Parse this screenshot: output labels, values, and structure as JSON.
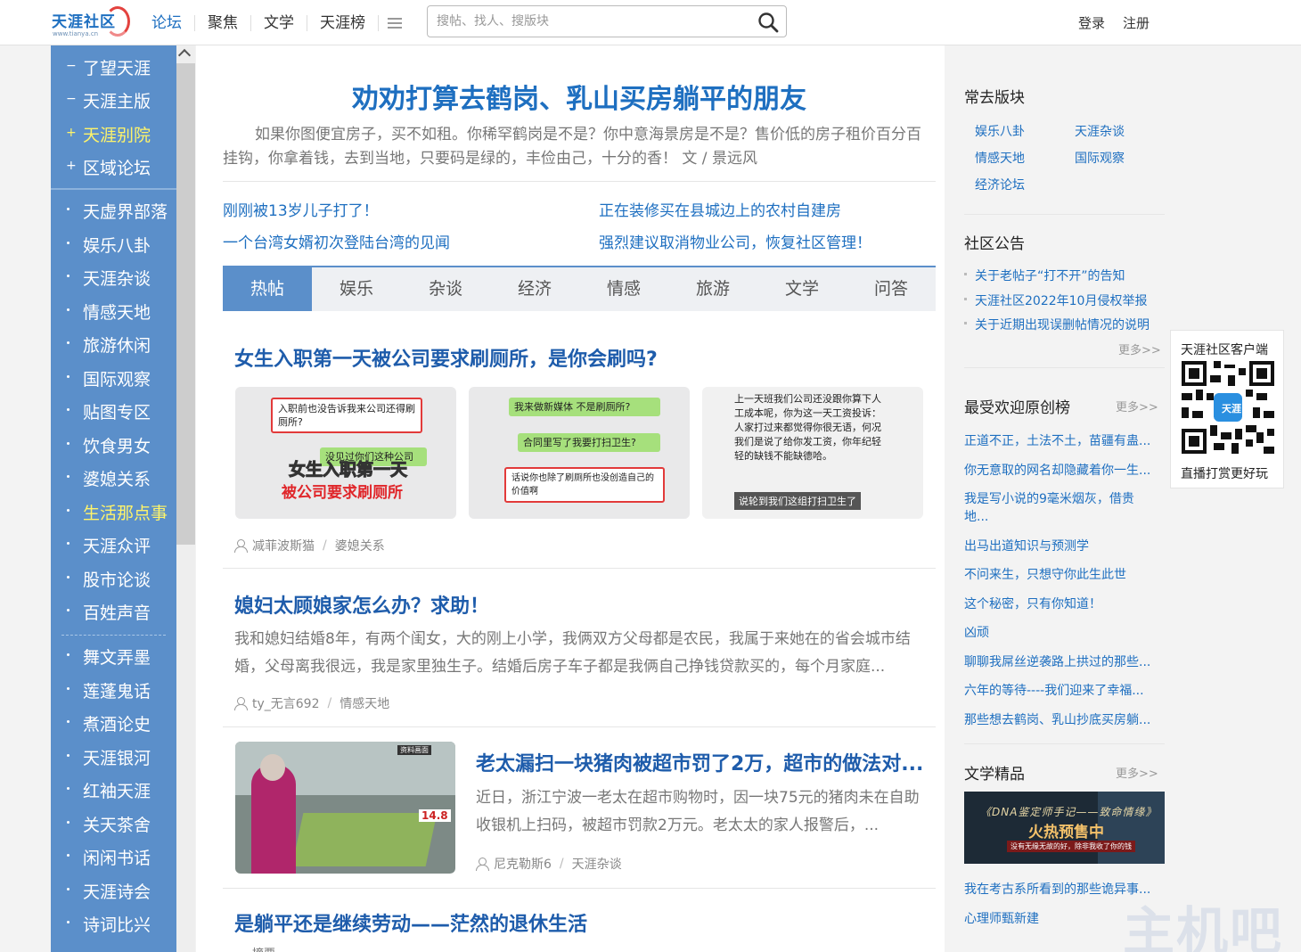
{
  "header": {
    "logo_text": "天涯社区",
    "logo_sub": "www.tianya.cn",
    "nav": [
      "论坛",
      "聚焦",
      "文学",
      "天涯榜"
    ],
    "search_placeholder": "搜帖、找人、搜版块",
    "login": "登录",
    "register": "注册"
  },
  "sidebar": {
    "top_items": [
      {
        "label": "了望天涯",
        "mark": "-",
        "active": false
      },
      {
        "label": "天涯主版",
        "mark": "-",
        "active": false
      },
      {
        "label": "天涯别院",
        "mark": "+",
        "active": true
      },
      {
        "label": "区域论坛",
        "mark": "+",
        "active": false
      }
    ],
    "group1": [
      "天虚界部落",
      "娱乐八卦",
      "天涯杂谈",
      "情感天地",
      "旅游休闲",
      "国际观察",
      "贴图专区",
      "饮食男女",
      "婆媳关系",
      "生活那点事",
      "天涯众评",
      "股市论谈",
      "百姓声音"
    ],
    "group1_active": "生活那点事",
    "group2": [
      "舞文弄墨",
      "莲蓬鬼话",
      "煮酒论史",
      "天涯银河",
      "红袖天涯",
      "关天茶舍",
      "闲闲书话",
      "天涯诗会",
      "诗词比兴"
    ]
  },
  "main": {
    "headline": "劝劝打算去鹤岗、乳山买房躺平的朋友",
    "summary": "如果你图便宜房子，买不如租。你稀罕鹤岗是不是？你中意海景房是不是？售价低的房子租价百分百挂钩，你拿着钱，去到当地，只要码是绿的，丰俭由己，十分的香！ 文 / 景远风",
    "links": [
      "刚刚被13岁儿子打了！",
      "正在装修买在县城边上的农村自建房",
      "一个台湾女婿初次登陆台湾的见闻",
      "强烈建议取消物业公司，恢复社区管理！"
    ],
    "tabs": [
      "热帖",
      "娱乐",
      "杂谈",
      "经济",
      "情感",
      "旅游",
      "文学",
      "问答"
    ],
    "active_tab": "热帖",
    "posts": [
      {
        "title": "女生入职第一天被公司要求刷厕所，是你会刷吗?",
        "author": "减菲波斯猫",
        "board": "婆媳关系",
        "thumbs": [
          {
            "chat1": "入职前也没告诉我来公司还得刷厕所?",
            "chat2": "没见过你们这种公司",
            "big1": "女生入职第一天",
            "big2": "被公司要求刷厕所"
          },
          {
            "chat1": "我来做新媒体 不是刷厕所?",
            "chat2": "合同里写了我要打扫卫生?",
            "chat3": "话说你也除了刷厕所也没创造自己的价值啊"
          },
          {
            "text": "上一天班我们公司还没跟你算下人工成本呢，你为这一天工资投诉：　　　　人家打过来都觉得你很无语，何况我们是说了给你发工资，你年纪轻轻的缺钱不能缺德哈。",
            "caption": "说轮到我们这组打扫卫生了"
          }
        ]
      },
      {
        "title": "媳妇太顾娘家怎么办？求助！",
        "excerpt": "我和媳妇结婚8年，有两个闺女，大的刚上小学，我俩双方父母都是农民，我属于来她在的省会城市结婚，父母离我很远，我是家里独生子。结婚后房子车子都是我俩自己挣钱贷款买的，每个月家庭...",
        "author": "ty_无言692",
        "board": "情感天地"
      },
      {
        "title": "老太漏扫一块猪肉被超市罚了2万，超市的做法对...",
        "excerpt": "近日，浙江宁波一老太在超市购物时，因一块75元的猪肉未在自助收银机上扫码，被超市罚款2万元。老太太的家人报警后，...",
        "author": "尼克勒斯6",
        "board": "天涯杂谈",
        "image_tag": "资料画面",
        "price_tag": "14.8"
      },
      {
        "title": "是躺平还是继续劳动——茫然的退休生活",
        "excerpt": "摘要..."
      }
    ]
  },
  "right": {
    "frequent_title": "常去版块",
    "frequent": [
      "娱乐八卦",
      "天涯杂谈",
      "情感天地",
      "国际观察",
      "经济论坛"
    ],
    "notice_title": "社区公告",
    "notices": [
      "关于老帖子“打不开”的告知",
      "天涯社区2022年10月侵权举报",
      "关于近期出现误删帖情况的说明"
    ],
    "more": "更多>>",
    "popular_title": "最受欢迎原创榜",
    "popular": [
      "正道不正，土法不土，苗疆有蛊...",
      "你无意取的网名却隐藏着你一生...",
      "我是写小说的9毫米烟灰，借贵",
      "地...",
      "出马出道知识与预测学",
      "不问来生，只想守你此生此世",
      "这个秘密，只有你知道！",
      "凶顽",
      "聊聊我屌丝逆袭路上拱过的那些...",
      "六年的等待----我们迎来了幸福...",
      "那些想去鹤岗、乳山抄底买房躺..."
    ],
    "literature_title": "文学精品",
    "banner": {
      "line1": "《DNA鉴定师手记——致命情缘》",
      "line2": "火热预售中",
      "line3": "没有无缘无故的好，除非我收了你的钱"
    },
    "literature": [
      "我在考古系所看到的那些诡异事...",
      "心理师甄新建"
    ],
    "qr": {
      "title": "天涯社区客户端",
      "caption": "直播打赏更好玩",
      "center": "天涯"
    }
  },
  "watermark": "主机吧",
  "colors": {
    "brand": "#1e6fc0",
    "sidebar": "#5b8fca",
    "highlight": "#fff46a"
  }
}
